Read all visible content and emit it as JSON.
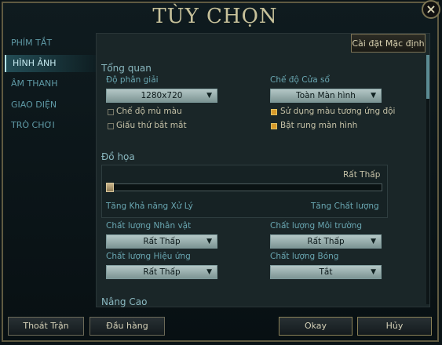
{
  "window": {
    "title": "TÙY CHỌN",
    "close_glyph": "×"
  },
  "sidebar": {
    "items": [
      {
        "label": "PHÍM TẮT"
      },
      {
        "label": "HÌNH ẢNH"
      },
      {
        "label": "ÂM THANH"
      },
      {
        "label": "GIAO DIỆN"
      },
      {
        "label": "TRÒ CHƠI"
      }
    ],
    "active_index": 1
  },
  "toolbar": {
    "defaults_label": "Cài đặt Mặc định"
  },
  "overview": {
    "title": "Tổng quan",
    "resolution_label": "Độ phân giải",
    "resolution_value": "1280x720",
    "window_mode_label": "Chế độ Cửa sổ",
    "window_mode_value": "Toàn Màn hình",
    "checkboxes": [
      {
        "label": "Chế độ mù màu",
        "checked": false
      },
      {
        "label": "Giấu thứ bắt mắt",
        "checked": false
      },
      {
        "label": "Sử dụng màu tương ứng đội",
        "checked": true
      },
      {
        "label": "Bật rung màn hình",
        "checked": true
      }
    ]
  },
  "graphics": {
    "title": "Đồ họa",
    "level_text": "Rất Thấp",
    "left_caption": "Tăng Khả năng Xử Lý",
    "right_caption": "Tăng Chất lượng",
    "slider_level": 0.0
  },
  "quality": {
    "character_label": "Chất lượng Nhân vật",
    "character_value": "Rất Thấp",
    "environment_label": "Chất lượng Môi trường",
    "environment_value": "Rất Thấp",
    "effects_label": "Chất lượng Hiệu ứng",
    "effects_value": "Rất Thấp",
    "shadows_label": "Chất lượng Bóng",
    "shadows_value": "Tắt"
  },
  "advanced": {
    "title": "Nâng Cao"
  },
  "footer": {
    "exit_label": "Thoát Trận",
    "surrender_label": "Đầu hàng",
    "ok_label": "Okay",
    "cancel_label": "Hủy"
  },
  "icons": {
    "dropdown_arrow": "▼",
    "close": "close-icon",
    "arrow": "chevron-down-icon"
  },
  "colors": {
    "accent_gold": "#d79a2b",
    "sidebar_text": "#5f9aa6",
    "background": "#0b1417"
  }
}
